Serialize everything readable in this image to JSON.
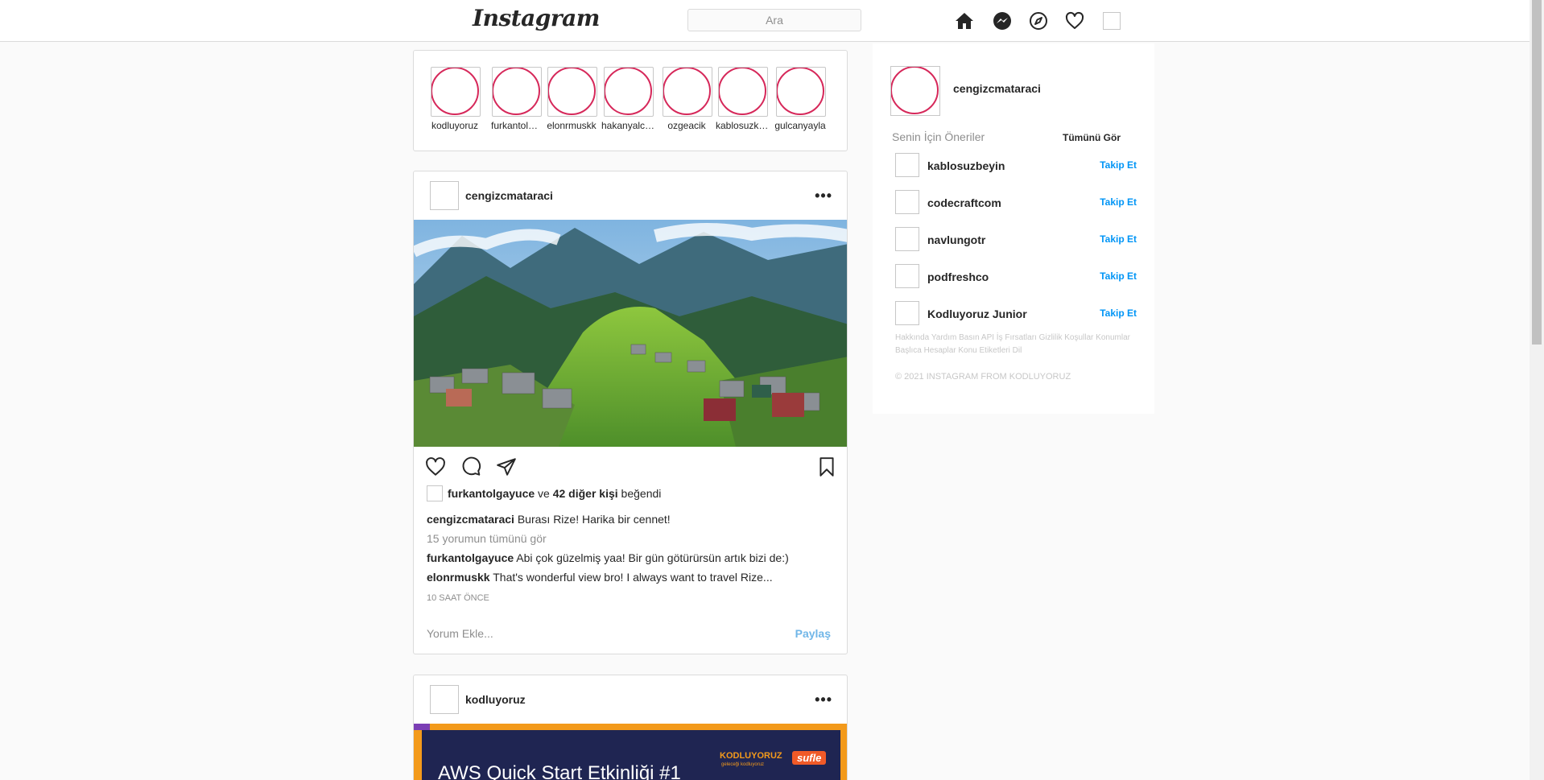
{
  "nav": {
    "logo": "Instagram",
    "search_placeholder": "Ara",
    "icons": [
      "home-icon",
      "messenger-icon",
      "explore-icon",
      "heart-icon",
      "profile-avatar"
    ]
  },
  "stories": [
    {
      "name": "kodluyoruz"
    },
    {
      "name": "furkantolgayuce"
    },
    {
      "name": "elonrmuskk"
    },
    {
      "name": "hakanyalcinkaya"
    },
    {
      "name": "ozgeacik"
    },
    {
      "name": "kablosuzkedi"
    },
    {
      "name": "gulcanyayla"
    }
  ],
  "post1": {
    "username": "cengizcmataraci",
    "more": "•••",
    "liked_by": "furkantolgayuce",
    "liked_and": "ve",
    "liked_others": "42 diğer kişi",
    "liked_suffix": "beğendi",
    "caption_user": "cengizcmataraci",
    "caption_text": "Burası Rize! Harika bir cennet!",
    "view_comments": "15 yorumun tümünü gör",
    "comments": [
      {
        "user": "furkantolgayuce",
        "text": "Abi çok güzelmiş yaa! Bir gün götürürsün artık bizi de:)"
      },
      {
        "user": "elonrmuskk",
        "text": "That's wonderful view bro! I always want to travel Rize..."
      }
    ],
    "time": "10 SAAT ÖNCE",
    "add_comment_placeholder": "Yorum Ekle...",
    "share_label": "Paylaş"
  },
  "post2": {
    "username": "kodluyoruz",
    "more": "•••",
    "banner_title": "AWS Quick Start Etkinliği #1",
    "banner_brand": "KODLUYORUZ",
    "banner_brand_sub": "geleceği kodluyoruz",
    "banner_badge": "sufle"
  },
  "sidebar": {
    "username": "cengizcmataraci",
    "suggestions_title": "Senin İçin Öneriler",
    "see_all": "Tümünü Gör",
    "suggestions": [
      {
        "name": "kablosuzbeyin",
        "action": "Takip Et"
      },
      {
        "name": "codecraftcom",
        "action": "Takip Et"
      },
      {
        "name": "navlungotr",
        "action": "Takip Et"
      },
      {
        "name": "podfreshco",
        "action": "Takip Et"
      },
      {
        "name": "Kodluyoruz Junior",
        "action": "Takip Et"
      }
    ],
    "footer_links": "Hakkında Yardım Basın API İş Fırsatları Gizlilik Koşullar Konumlar Başlıca Hesaplar Konu Etiketleri Dil",
    "copyright": "© 2021 INSTAGRAM FROM KODLUYORUZ"
  },
  "colors": {
    "story_ring": "#d6285a",
    "link_blue": "#0095f6",
    "share_blue": "#70b6e8",
    "border": "#dbdbdb"
  }
}
